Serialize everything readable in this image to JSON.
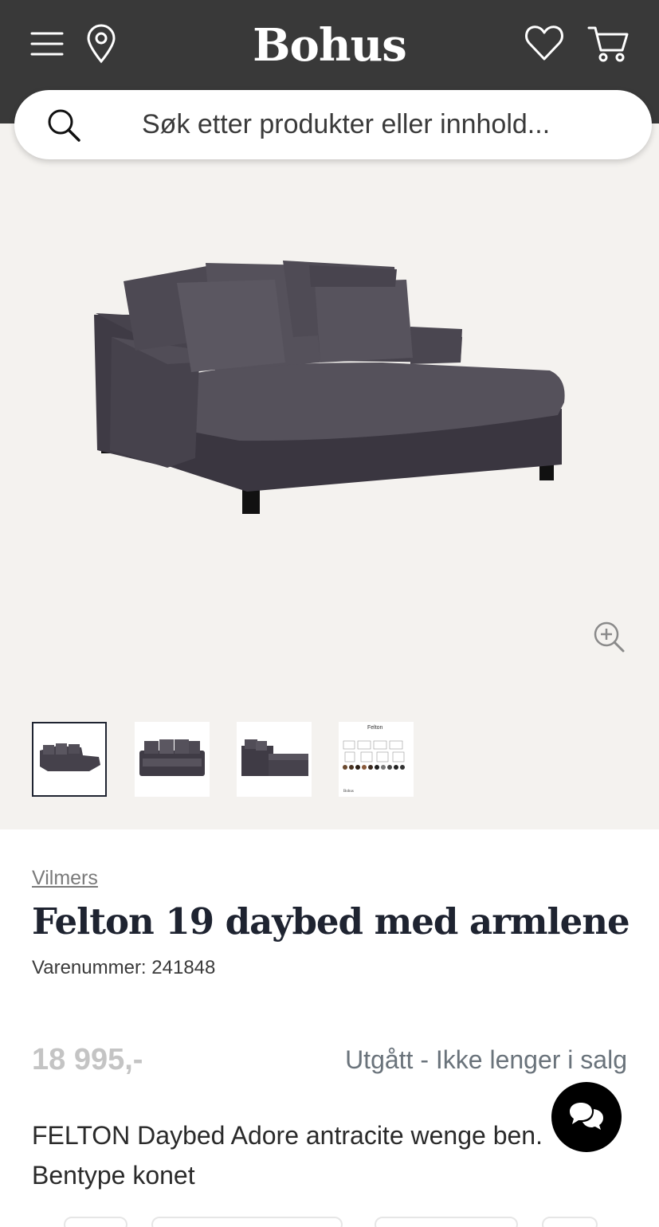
{
  "header": {
    "logo": "Bohus",
    "icons": [
      "menu-icon",
      "location-icon",
      "heart-icon",
      "cart-icon"
    ],
    "background_color": "#393939"
  },
  "search": {
    "placeholder": "Søk etter produkter eller innhold..."
  },
  "gallery": {
    "thumbnails": [
      {
        "name": "thumb-daybed-angle",
        "active": true
      },
      {
        "name": "thumb-daybed-front",
        "active": false
      },
      {
        "name": "thumb-daybed-side",
        "active": false
      },
      {
        "name": "thumb-spec-sheet",
        "active": false
      }
    ],
    "spec_sheet": {
      "title": "Felton",
      "brand": "Bohus"
    },
    "background_color": "#f4f2ef"
  },
  "product": {
    "brand": "Vilmers",
    "title": "Felton 19 daybed med armlene",
    "sku": "Varenummer: 241848",
    "price": "18 995,-",
    "status": "Utgått - Ikke lenger i salg",
    "description": "FELTON Daybed Adore antracite wenge ben. Bentype konet",
    "sofa_color": "#4a4650"
  },
  "chat": {
    "icon": "chat-bubbles-icon"
  }
}
